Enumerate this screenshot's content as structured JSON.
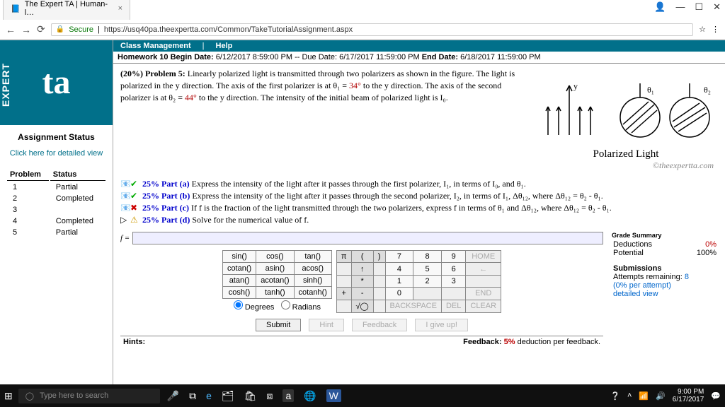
{
  "browser": {
    "tab_title": "The Expert TA | Human-l…",
    "url_prefix": "Secure",
    "url": "https://usq40pa.theexpertta.com/Common/TakeTutorialAssignment.aspx"
  },
  "sidebar": {
    "logo_text": "ta",
    "expert_text": "EXPERT",
    "heading": "Assignment Status",
    "click_here": "Click here for detailed view",
    "col1": "Problem",
    "col2": "Status",
    "rows": [
      {
        "n": "1",
        "s": "Partial"
      },
      {
        "n": "2",
        "s": "Completed"
      },
      {
        "n": "3",
        "s": ""
      },
      {
        "n": "4",
        "s": "Completed"
      },
      {
        "n": "5",
        "s": "Partial"
      }
    ]
  },
  "topbar": {
    "a": "Class Management",
    "b": "Help"
  },
  "hw": {
    "label": "Homework 10",
    "begin_l": "Begin Date:",
    "begin": "6/12/2017 8:59:00 PM",
    "due_l": "-- Due Date:",
    "due": "6/17/2017 11:59:00 PM",
    "end_l": "End Date:",
    "end": "6/18/2017 11:59:00 PM"
  },
  "problem": {
    "pct": "(20%)",
    "title": "Problem 5:",
    "body1": "Linearly polarized light is transmitted through two polarizers as shown in the figure. The light is polarized in the y direction. The axis of the first polarizer is at θ₁ = ",
    "theta1": "34°",
    "body2": " to the y direction. The axis of the second polarizer is at θ₂ = ",
    "theta2": "44°",
    "body3": " to the y direction. The intensity of the initial beam of polarized light is I₀."
  },
  "figure": {
    "y_label": "y",
    "th1": "θ₁",
    "th2": "θ₂",
    "caption": "Polarized Light",
    "watermark": "©theexpertta.com"
  },
  "parts": {
    "a_pct": "25% Part (a)",
    "a_txt": "Express the intensity of the light after it passes through the first polarizer, I₁, in terms of I₀, and θ₁.",
    "b_pct": "25% Part (b)",
    "b_txt": "Express the intensity of the light after it passes through the second polarizer, I₂, in terms of I₁, Δθ₁₂, where Δθ₁₂ = θ₂ - θ₁.",
    "c_pct": "25% Part (c)",
    "c_txt": "If f is the fraction of the light transmitted through the two polarizers, express f in terms of θ₁ and Δθ₁₂, where Δθ₁₂ = θ₂ - θ₁.",
    "d_pct": "25% Part (d)",
    "d_txt": "Solve for the numerical value of f."
  },
  "answer": {
    "f_label": "f =",
    "funcs": [
      [
        "sin()",
        "cos()",
        "tan()"
      ],
      [
        "cotan()",
        "asin()",
        "acos()"
      ],
      [
        "atan()",
        "acotan()",
        "sinh()"
      ],
      [
        "cosh()",
        "tanh()",
        "cotanh()"
      ]
    ],
    "nums": [
      [
        "π",
        "(",
        ")",
        "7",
        "8",
        "9",
        "HOME"
      ],
      [
        "",
        "↑",
        "",
        "4",
        "5",
        "6",
        "←"
      ],
      [
        "",
        "*",
        "",
        "1",
        "2",
        "3",
        ""
      ],
      [
        "+",
        "-",
        "",
        "0",
        "",
        "",
        "END"
      ],
      [
        "",
        "√◯",
        "",
        "BACKSPACE",
        "",
        "DEL",
        "CLEAR"
      ]
    ],
    "deg": "Degrees",
    "rad": "Radians",
    "btns": {
      "submit": "Submit",
      "hint": "Hint",
      "fb": "Feedback",
      "give": "I give up!"
    },
    "hints_l": "Hints:",
    "fb_l": "Feedback:",
    "fb_pct": "5%",
    "fb_txt": "deduction per feedback."
  },
  "grade": {
    "title": "Grade Summary",
    "ded_l": "Deductions",
    "ded_v": "0%",
    "pot_l": "Potential",
    "pot_v": "100%",
    "sub_title": "Submissions",
    "att_l": "Attempts remaining:",
    "att_v": "8",
    "per": "(0% per attempt)",
    "detail": "detailed view"
  },
  "taskbar": {
    "search_ph": "Type here to search",
    "time": "9:00 PM",
    "date": "6/17/2017"
  }
}
